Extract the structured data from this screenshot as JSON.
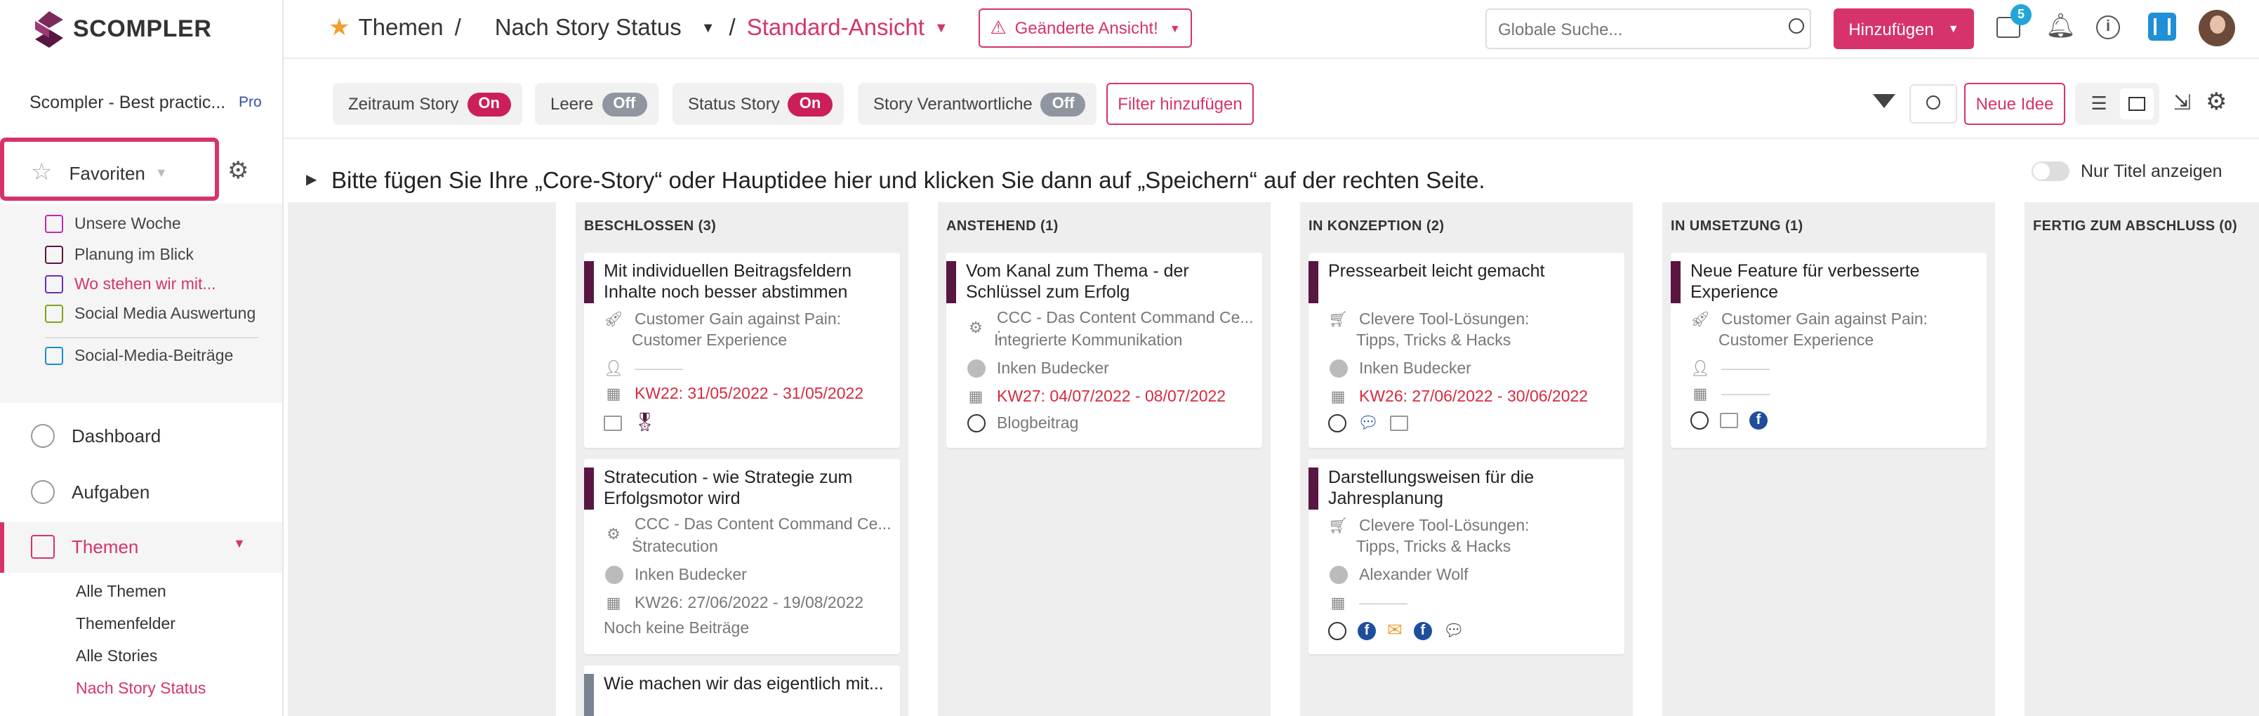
{
  "app": {
    "name": "SCOMPLER",
    "workspace": "Scompler - Best practic...",
    "plan": "Pro"
  },
  "breadcrumb": {
    "root": "Themen",
    "sep1": "/",
    "view": "Nach Story Status",
    "sep2": "/",
    "current": "Standard-Ansicht"
  },
  "changed_view": "Geänderte Ansicht!",
  "search": {
    "placeholder": "Globale Suche..."
  },
  "add_button": "Hinzufügen",
  "notification_badge": "5",
  "filters": [
    {
      "label": "Zeitraum Story",
      "state": "On"
    },
    {
      "label": "Leere",
      "state": "Off"
    },
    {
      "label": "Status Story",
      "state": "On"
    },
    {
      "label": "Story Verantwortliche",
      "state": "Off"
    }
  ],
  "add_filter": "Filter hinzufügen",
  "new_idea": "Neue Idee",
  "core_story": "Bitte fügen Sie Ihre „Core-Story“ oder Hauptidee hier und klicken Sie dann auf „Speichern“ auf der rechten Seite.",
  "only_titles": "Nur Titel anzeigen",
  "favorites": {
    "label": "Favoriten",
    "items": [
      {
        "label": "Unsere Woche",
        "color": "#c026b8"
      },
      {
        "label": "Planung im Blick",
        "color": "#5a1642"
      },
      {
        "label": "Wo stehen wir mit...",
        "color": "#6a2fb0"
      },
      {
        "label": "Social Media Auswertung",
        "color": "#7ea31c"
      },
      {
        "label": "Social-Media-Beiträge",
        "color": "#1a8fc9"
      }
    ]
  },
  "nav": {
    "dashboard": "Dashboard",
    "tasks": "Aufgaben",
    "themes": "Themen",
    "sub": [
      "Alle Themen",
      "Themenfelder",
      "Alle Stories",
      "Nach Story Status"
    ]
  },
  "columns": [
    {
      "title": "BESCHLOSSEN (3)",
      "cards": [
        {
          "title": "Mit individuellen Beitragsfeldern Inhalte noch besser abstimmen",
          "l1": "Customer Gain against Pain:",
          "l2": "Customer Experience",
          "person": "———",
          "date": "KW22: 31/05/2022 - 31/05/2022"
        },
        {
          "title": "Stratecution - wie Strategie zum Erfolgsmotor wird",
          "l1": "CCC - Das Content Command Ce... :",
          "l2": "Stratecution",
          "person": "Inken Budecker",
          "date": "KW26: 27/06/2022 - 19/08/2022",
          "extra": "Noch keine Beiträge"
        },
        {
          "title": "Wie machen wir das eigentlich mit..."
        }
      ]
    },
    {
      "title": "ANSTEHEND (1)",
      "cards": [
        {
          "title": "Vom Kanal zum Thema - der Schlüssel zum Erfolg",
          "l1": "CCC - Das Content Command Ce... :",
          "l2": "Integrierte Kommunikation",
          "person": "Inken Budecker",
          "date": "KW27: 04/07/2022 - 08/07/2022",
          "extra": "Blogbeitrag"
        }
      ]
    },
    {
      "title": "IN KONZEPTION (2)",
      "cards": [
        {
          "title": "Pressearbeit leicht gemacht",
          "l1": "Clevere Tool-Lösungen:",
          "l2": "Tipps, Tricks & Hacks",
          "person": "Inken Budecker",
          "date": "KW26: 27/06/2022 - 30/06/2022"
        },
        {
          "title": "Darstellungsweisen für die Jahresplanung",
          "l1": "Clevere Tool-Lösungen:",
          "l2": "Tipps, Tricks & Hacks",
          "person": "Alexander Wolf",
          "date": "———"
        }
      ]
    },
    {
      "title": "IN UMSETZUNG (1)",
      "cards": [
        {
          "title": "Neue Feature für verbesserte Experience",
          "l1": "Customer Gain against Pain:",
          "l2": "Customer Experience",
          "person": "———",
          "date": "———"
        }
      ]
    },
    {
      "title": "FERTIG ZUM ABSCHLUSS (0)",
      "cards": []
    }
  ]
}
